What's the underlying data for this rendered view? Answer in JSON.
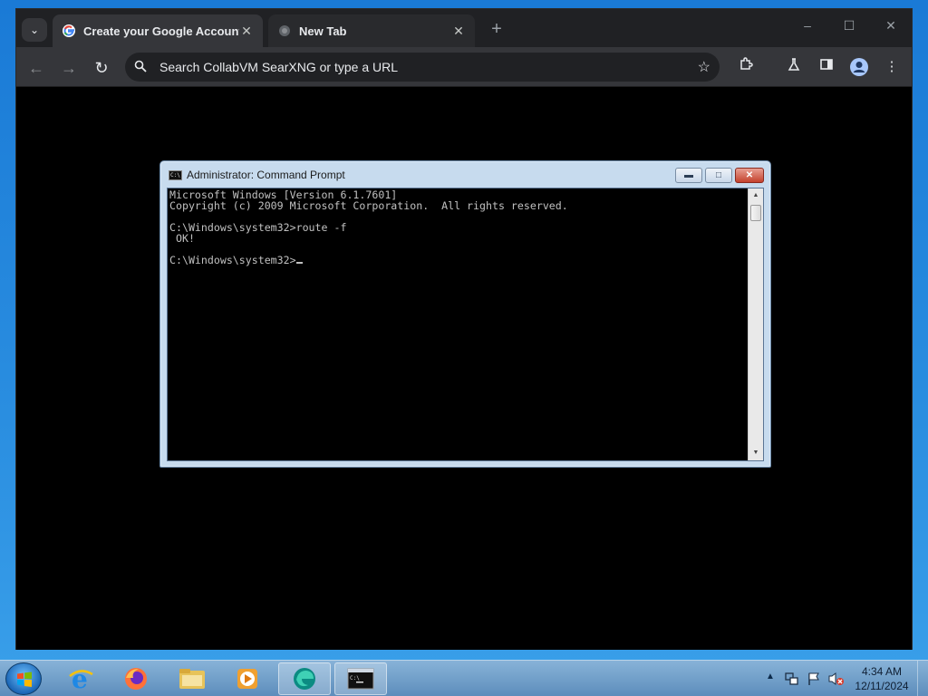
{
  "browser": {
    "tabs": [
      {
        "label": "Create your Google Account",
        "favicon": "google-g-icon",
        "active": true
      },
      {
        "label": "New Tab",
        "favicon": "globe-icon",
        "active": false
      }
    ],
    "omnibox_placeholder": "Search CollabVM SearXNG or type a URL"
  },
  "cmd": {
    "title": "Administrator: Command Prompt",
    "lines": [
      "Microsoft Windows [Version 6.1.7601]",
      "Copyright (c) 2009 Microsoft Corporation.  All rights reserved.",
      "",
      "C:\\Windows\\system32>route -f",
      " OK!",
      ""
    ],
    "prompt": "C:\\Windows\\system32>"
  },
  "taskbar": {
    "apps": [
      "internet-explorer-icon",
      "firefox-icon",
      "file-explorer-icon",
      "media-player-icon",
      "edge-icon",
      "cmd-icon"
    ],
    "clock_time": "4:34 AM",
    "clock_date": "12/11/2024"
  },
  "colors": {
    "tabstrip": "#202124",
    "toolbar": "#35363a",
    "cmd_frame": "#c7dbee",
    "close_red": "#c4412c",
    "taskbar": "#7faad2"
  }
}
